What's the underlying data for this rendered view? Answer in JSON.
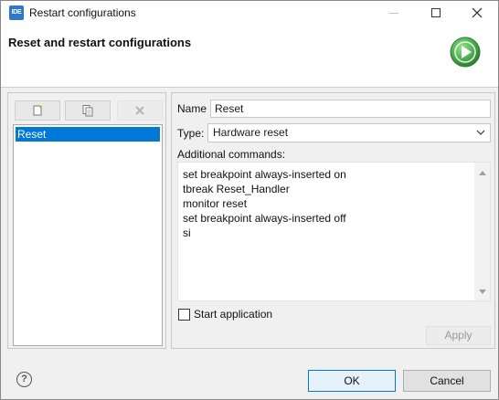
{
  "window": {
    "app_icon_text": "IDE",
    "title": "Restart configurations"
  },
  "header": {
    "title": "Reset and restart configurations",
    "icon": "run-icon"
  },
  "toolbar": {
    "new_icon": "new-config-icon",
    "duplicate_icon": "duplicate-icon",
    "delete_icon": "delete-icon"
  },
  "config_list": {
    "items": [
      "Reset"
    ],
    "selected": "Reset"
  },
  "form": {
    "name_label": "Name",
    "name_value": "Reset",
    "type_label": "Type:",
    "type_value": "Hardware reset",
    "commands_label": "Additional commands:",
    "commands": [
      "set breakpoint always-inserted on",
      "tbreak Reset_Handler",
      "monitor reset",
      "set breakpoint always-inserted off",
      "si"
    ],
    "start_app_label": "Start application",
    "start_app_checked": false,
    "apply_label": "Apply"
  },
  "footer": {
    "help_glyph": "?",
    "ok_label": "OK",
    "cancel_label": "Cancel"
  },
  "colors": {
    "selection": "#0078d7",
    "run_icon": "#4caf50"
  }
}
